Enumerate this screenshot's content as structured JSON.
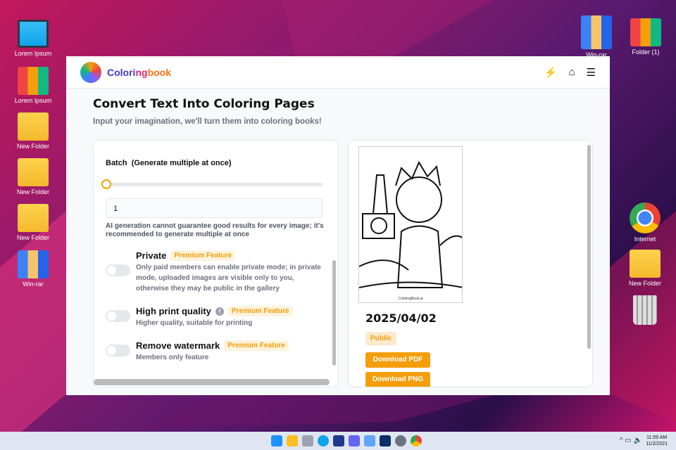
{
  "desktop": {
    "icons_left": [
      "Lorem Ipsum",
      "Lorem Ipsum",
      "New Folder",
      "New Folder",
      "New Folder",
      "Win-rar"
    ],
    "icons_right": [
      "Win-rar",
      "Folder (1)",
      "Internet",
      "New Folder"
    ]
  },
  "app": {
    "brand": {
      "part1": "Colori",
      "part2": "ng",
      "part3": "book"
    },
    "title": "Convert Text Into Coloring Pages",
    "subtitle": "Input your imagination, we'll turn them into coloring books!",
    "batch": {
      "label": "Batch",
      "hint": "(Generate multiple at once)",
      "value": "1",
      "slider_value": 1,
      "note": "AI generation cannot guarantee good results for every image; it's recommended to generate multiple at once"
    },
    "options": [
      {
        "title": "Private",
        "badge": "Premium Feature",
        "desc": "Only paid members can enable private mode; in private mode, uploaded images are visible only to you, otherwise they may be public in the gallery",
        "enabled": false
      },
      {
        "title": "High print quality",
        "badge": "Premium Feature",
        "desc": "Higher quality, suitable for printing",
        "enabled": false
      },
      {
        "title": "Remove watermark",
        "badge": "Premium Feature",
        "desc": "Members only feature",
        "enabled": false
      }
    ],
    "result": {
      "watermark": "ColoringBook.ai",
      "date": "2025/04/02",
      "visibility": "Public",
      "download_pdf": "Download PDF",
      "download_png": "Download PNG"
    }
  },
  "taskbar": {
    "time": "11:59 AM",
    "date": "11/2/2021"
  }
}
